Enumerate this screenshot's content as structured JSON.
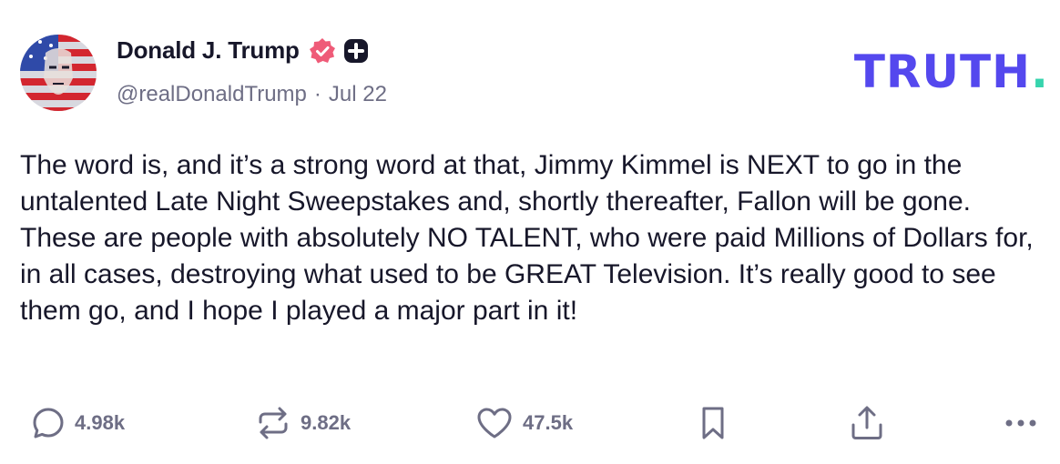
{
  "header": {
    "display_name": "Donald J. Trump",
    "handle": "@realDonaldTrump",
    "separator": "·",
    "date": "Jul 22",
    "logo_text": "TRUTH",
    "logo_dot": "."
  },
  "post": {
    "text": "The word is, and it’s a strong word at that, Jimmy Kimmel is NEXT to go in the untalented Late Night Sweepstakes and, shortly thereafter, Fallon will be gone. These are people with absolutely NO TALENT, who were paid Millions of Dollars for, in all cases, destroying what used to be GREAT Television. It’s really good to see them go, and I hope I played a major part in it!"
  },
  "actions": {
    "replies": "4.98k",
    "retruths": "9.82k",
    "likes": "47.5k"
  },
  "icons": {
    "verified": "verified-badge-icon",
    "plus": "plus-badge-icon",
    "reply": "reply-icon",
    "retruth": "retruth-icon",
    "like": "heart-icon",
    "bookmark": "bookmark-icon",
    "share": "share-icon",
    "more": "more-icon"
  },
  "colors": {
    "brand": "#5448ee",
    "brand_accent": "#37d4ad",
    "verified": "#ef5b78",
    "text": "#17172a",
    "muted": "#6e6e85"
  }
}
